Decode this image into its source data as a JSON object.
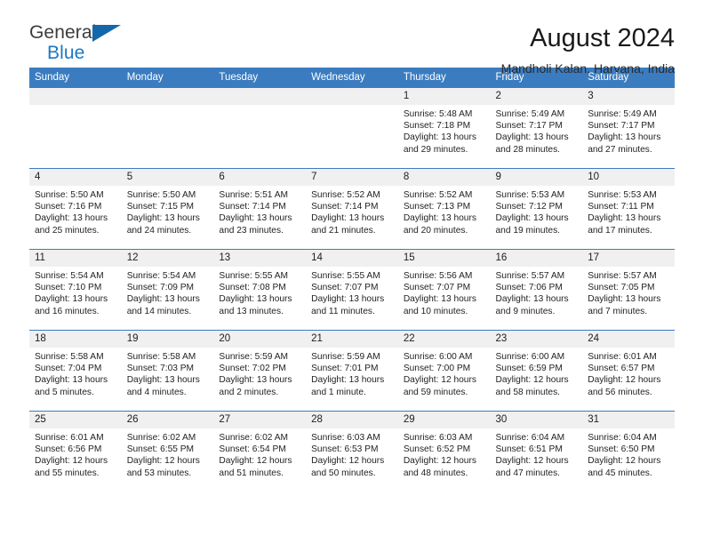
{
  "brand": {
    "name_top": "General",
    "name_bottom": "Blue",
    "accent_color": "#1368ab"
  },
  "header": {
    "title": "August 2024",
    "subtitle": "Mandholi Kalan, Haryana, India",
    "header_bg": "#3b7cc0",
    "daynum_bg": "#f0f0f0"
  },
  "weekdays": [
    "Sunday",
    "Monday",
    "Tuesday",
    "Wednesday",
    "Thursday",
    "Friday",
    "Saturday"
  ],
  "weeks": [
    [
      {
        "empty": true
      },
      {
        "empty": true
      },
      {
        "empty": true
      },
      {
        "empty": true
      },
      {
        "day": "1",
        "sunrise": "Sunrise: 5:48 AM",
        "sunset": "Sunset: 7:18 PM",
        "daylight1": "Daylight: 13 hours",
        "daylight2": "and 29 minutes."
      },
      {
        "day": "2",
        "sunrise": "Sunrise: 5:49 AM",
        "sunset": "Sunset: 7:17 PM",
        "daylight1": "Daylight: 13 hours",
        "daylight2": "and 28 minutes."
      },
      {
        "day": "3",
        "sunrise": "Sunrise: 5:49 AM",
        "sunset": "Sunset: 7:17 PM",
        "daylight1": "Daylight: 13 hours",
        "daylight2": "and 27 minutes."
      }
    ],
    [
      {
        "day": "4",
        "sunrise": "Sunrise: 5:50 AM",
        "sunset": "Sunset: 7:16 PM",
        "daylight1": "Daylight: 13 hours",
        "daylight2": "and 25 minutes."
      },
      {
        "day": "5",
        "sunrise": "Sunrise: 5:50 AM",
        "sunset": "Sunset: 7:15 PM",
        "daylight1": "Daylight: 13 hours",
        "daylight2": "and 24 minutes."
      },
      {
        "day": "6",
        "sunrise": "Sunrise: 5:51 AM",
        "sunset": "Sunset: 7:14 PM",
        "daylight1": "Daylight: 13 hours",
        "daylight2": "and 23 minutes."
      },
      {
        "day": "7",
        "sunrise": "Sunrise: 5:52 AM",
        "sunset": "Sunset: 7:14 PM",
        "daylight1": "Daylight: 13 hours",
        "daylight2": "and 21 minutes."
      },
      {
        "day": "8",
        "sunrise": "Sunrise: 5:52 AM",
        "sunset": "Sunset: 7:13 PM",
        "daylight1": "Daylight: 13 hours",
        "daylight2": "and 20 minutes."
      },
      {
        "day": "9",
        "sunrise": "Sunrise: 5:53 AM",
        "sunset": "Sunset: 7:12 PM",
        "daylight1": "Daylight: 13 hours",
        "daylight2": "and 19 minutes."
      },
      {
        "day": "10",
        "sunrise": "Sunrise: 5:53 AM",
        "sunset": "Sunset: 7:11 PM",
        "daylight1": "Daylight: 13 hours",
        "daylight2": "and 17 minutes."
      }
    ],
    [
      {
        "day": "11",
        "sunrise": "Sunrise: 5:54 AM",
        "sunset": "Sunset: 7:10 PM",
        "daylight1": "Daylight: 13 hours",
        "daylight2": "and 16 minutes."
      },
      {
        "day": "12",
        "sunrise": "Sunrise: 5:54 AM",
        "sunset": "Sunset: 7:09 PM",
        "daylight1": "Daylight: 13 hours",
        "daylight2": "and 14 minutes."
      },
      {
        "day": "13",
        "sunrise": "Sunrise: 5:55 AM",
        "sunset": "Sunset: 7:08 PM",
        "daylight1": "Daylight: 13 hours",
        "daylight2": "and 13 minutes."
      },
      {
        "day": "14",
        "sunrise": "Sunrise: 5:55 AM",
        "sunset": "Sunset: 7:07 PM",
        "daylight1": "Daylight: 13 hours",
        "daylight2": "and 11 minutes."
      },
      {
        "day": "15",
        "sunrise": "Sunrise: 5:56 AM",
        "sunset": "Sunset: 7:07 PM",
        "daylight1": "Daylight: 13 hours",
        "daylight2": "and 10 minutes."
      },
      {
        "day": "16",
        "sunrise": "Sunrise: 5:57 AM",
        "sunset": "Sunset: 7:06 PM",
        "daylight1": "Daylight: 13 hours",
        "daylight2": "and 9 minutes."
      },
      {
        "day": "17",
        "sunrise": "Sunrise: 5:57 AM",
        "sunset": "Sunset: 7:05 PM",
        "daylight1": "Daylight: 13 hours",
        "daylight2": "and 7 minutes."
      }
    ],
    [
      {
        "day": "18",
        "sunrise": "Sunrise: 5:58 AM",
        "sunset": "Sunset: 7:04 PM",
        "daylight1": "Daylight: 13 hours",
        "daylight2": "and 5 minutes."
      },
      {
        "day": "19",
        "sunrise": "Sunrise: 5:58 AM",
        "sunset": "Sunset: 7:03 PM",
        "daylight1": "Daylight: 13 hours",
        "daylight2": "and 4 minutes."
      },
      {
        "day": "20",
        "sunrise": "Sunrise: 5:59 AM",
        "sunset": "Sunset: 7:02 PM",
        "daylight1": "Daylight: 13 hours",
        "daylight2": "and 2 minutes."
      },
      {
        "day": "21",
        "sunrise": "Sunrise: 5:59 AM",
        "sunset": "Sunset: 7:01 PM",
        "daylight1": "Daylight: 13 hours",
        "daylight2": "and 1 minute."
      },
      {
        "day": "22",
        "sunrise": "Sunrise: 6:00 AM",
        "sunset": "Sunset: 7:00 PM",
        "daylight1": "Daylight: 12 hours",
        "daylight2": "and 59 minutes."
      },
      {
        "day": "23",
        "sunrise": "Sunrise: 6:00 AM",
        "sunset": "Sunset: 6:59 PM",
        "daylight1": "Daylight: 12 hours",
        "daylight2": "and 58 minutes."
      },
      {
        "day": "24",
        "sunrise": "Sunrise: 6:01 AM",
        "sunset": "Sunset: 6:57 PM",
        "daylight1": "Daylight: 12 hours",
        "daylight2": "and 56 minutes."
      }
    ],
    [
      {
        "day": "25",
        "sunrise": "Sunrise: 6:01 AM",
        "sunset": "Sunset: 6:56 PM",
        "daylight1": "Daylight: 12 hours",
        "daylight2": "and 55 minutes."
      },
      {
        "day": "26",
        "sunrise": "Sunrise: 6:02 AM",
        "sunset": "Sunset: 6:55 PM",
        "daylight1": "Daylight: 12 hours",
        "daylight2": "and 53 minutes."
      },
      {
        "day": "27",
        "sunrise": "Sunrise: 6:02 AM",
        "sunset": "Sunset: 6:54 PM",
        "daylight1": "Daylight: 12 hours",
        "daylight2": "and 51 minutes."
      },
      {
        "day": "28",
        "sunrise": "Sunrise: 6:03 AM",
        "sunset": "Sunset: 6:53 PM",
        "daylight1": "Daylight: 12 hours",
        "daylight2": "and 50 minutes."
      },
      {
        "day": "29",
        "sunrise": "Sunrise: 6:03 AM",
        "sunset": "Sunset: 6:52 PM",
        "daylight1": "Daylight: 12 hours",
        "daylight2": "and 48 minutes."
      },
      {
        "day": "30",
        "sunrise": "Sunrise: 6:04 AM",
        "sunset": "Sunset: 6:51 PM",
        "daylight1": "Daylight: 12 hours",
        "daylight2": "and 47 minutes."
      },
      {
        "day": "31",
        "sunrise": "Sunrise: 6:04 AM",
        "sunset": "Sunset: 6:50 PM",
        "daylight1": "Daylight: 12 hours",
        "daylight2": "and 45 minutes."
      }
    ]
  ]
}
